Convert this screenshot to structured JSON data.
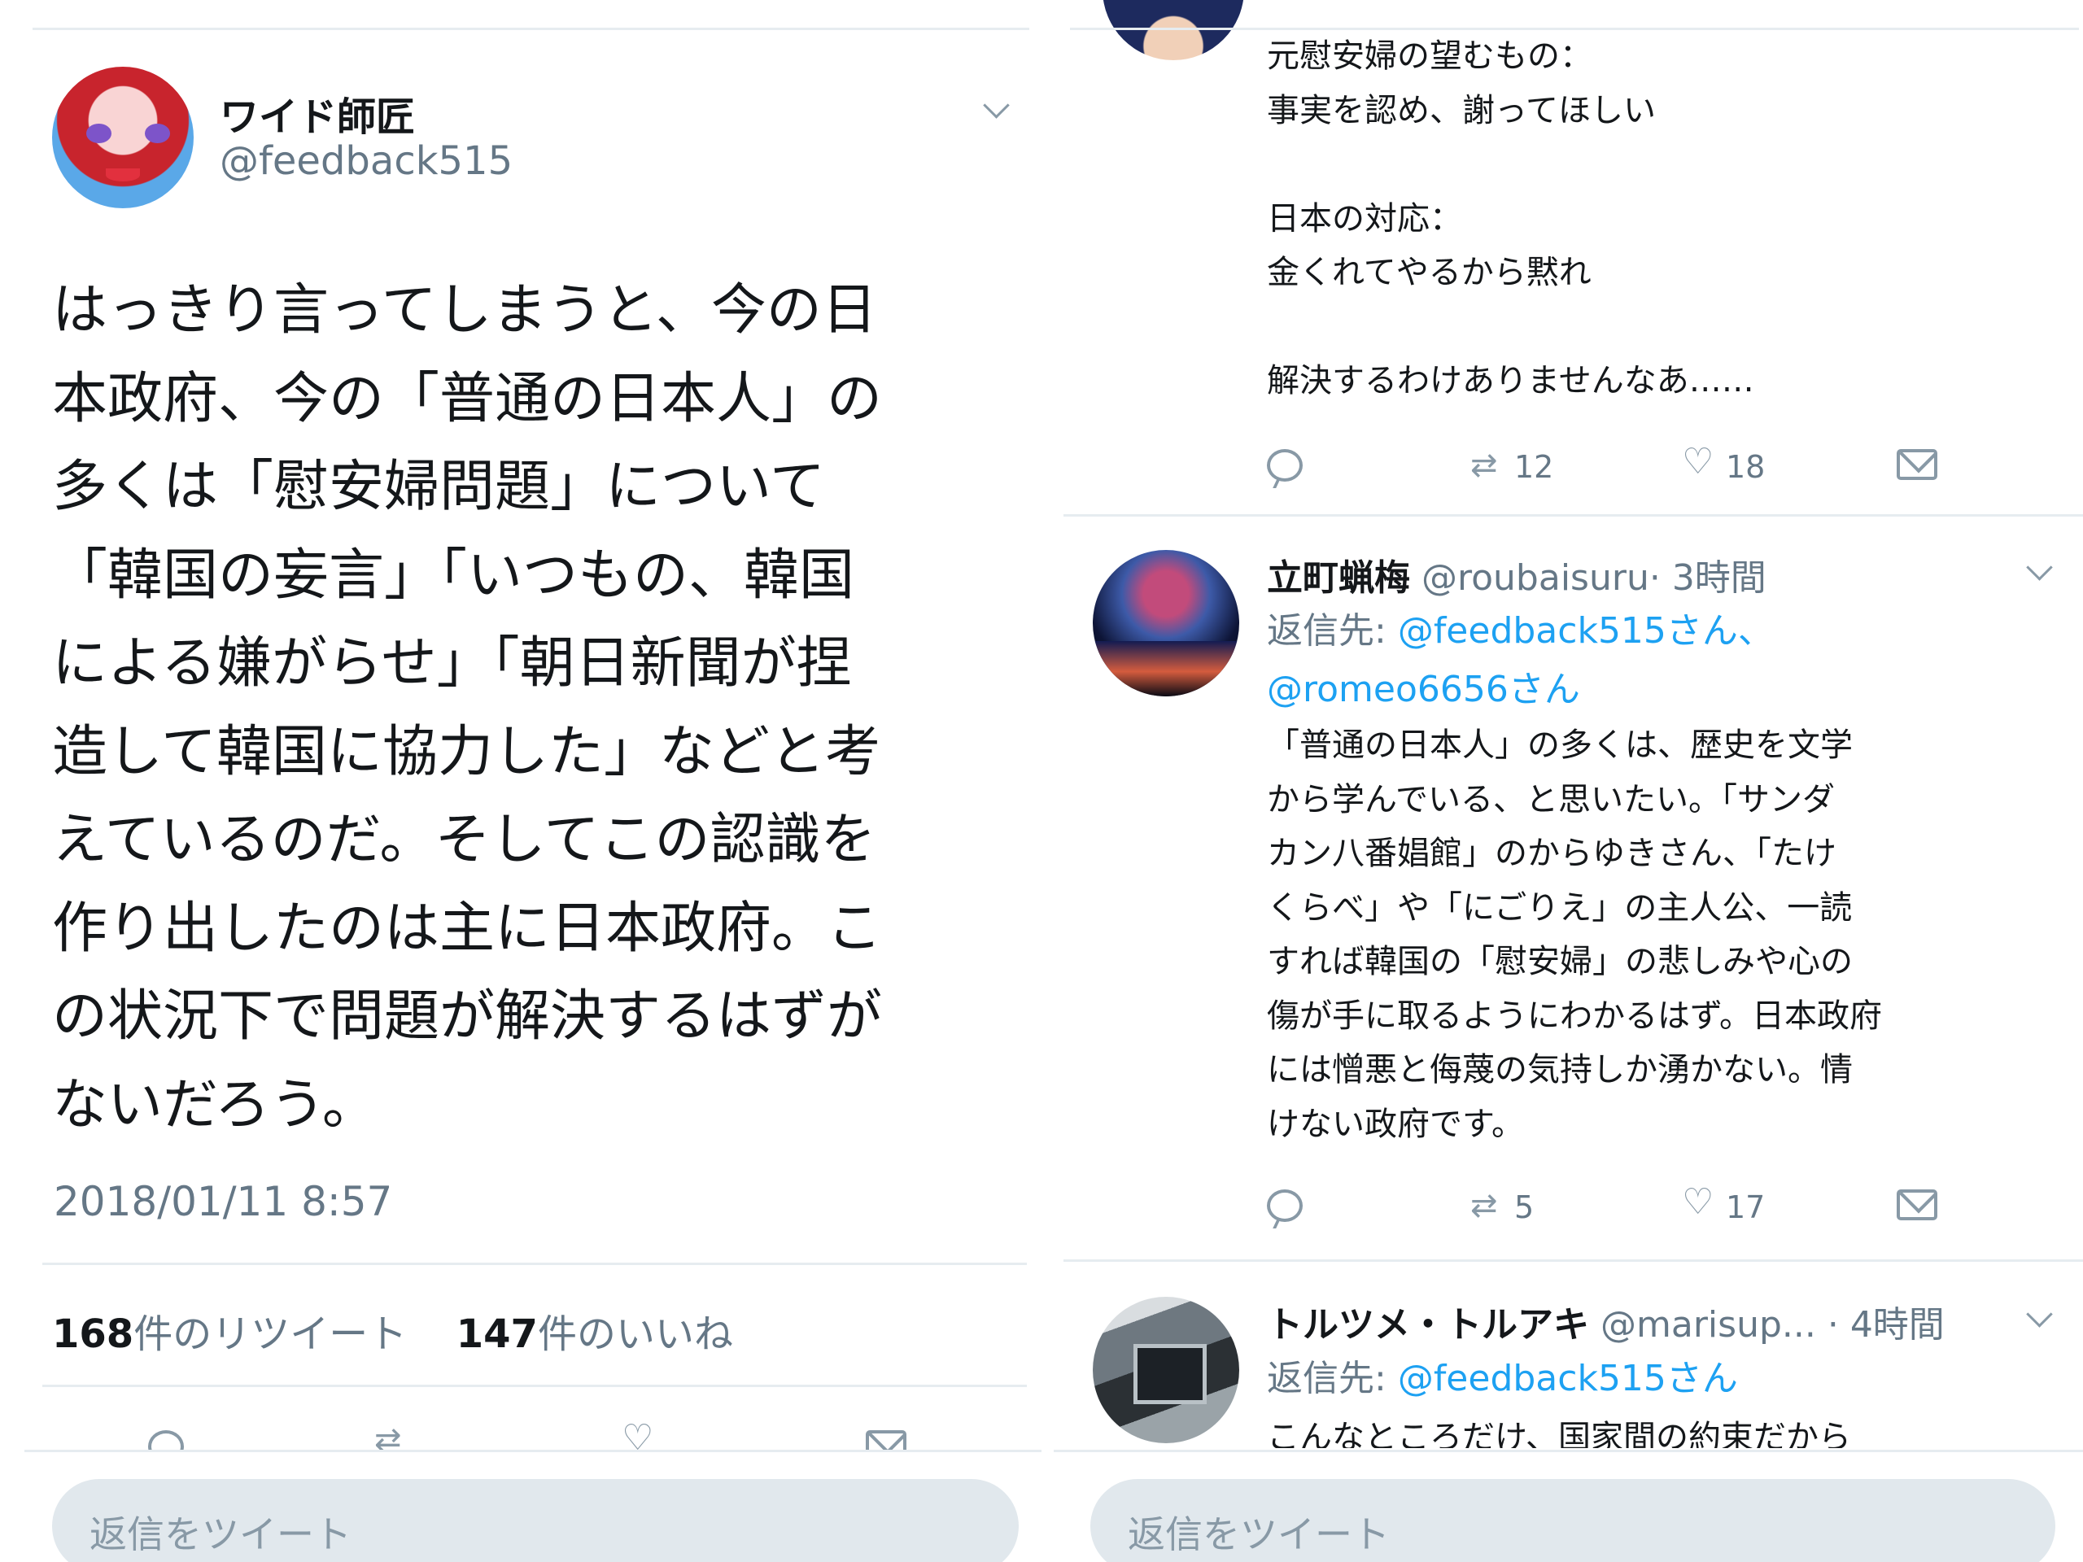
{
  "left": {
    "author": {
      "name": "ワイド師匠",
      "handle": "@feedback515"
    },
    "body_lines": [
      "はっきり言ってしまうと、今の日",
      "本政府、今の「普通の日本人」の",
      "多くは「慰安婦問題」について",
      "「韓国の妄言」「いつもの、韓国",
      "による嫌がらせ」「朝日新聞が捏",
      "造して韓国に協力した」などと考",
      "えているのだ。そしてこの認識を",
      "作り出したのは主に日本政府。こ",
      "の状況下で問題が解決するはずが",
      "ないだろう。"
    ],
    "timestamp": "2018/01/11 8:57",
    "stats": {
      "retweet_count": "168",
      "retweet_label": "件のリツイート",
      "like_count": "147",
      "like_label": "件のいいね"
    },
    "reply_placeholder": "返信をツイート"
  },
  "right": {
    "tweet1": {
      "text": "元慰安婦の望むもの：\n事実を認め、謝ってほしい\n\n日本の対応：\n金くれてやるから黙れ\n\n解決するわけありませんなあ……",
      "retweets": "12",
      "likes": "18"
    },
    "tweet2": {
      "name": "立町蝋梅",
      "handle": "@roubaisuru",
      "time": "· 3時間",
      "reply_prefix": "返信先: ",
      "reply_to_1": "@feedback515さん、",
      "reply_to_2": "@romeo6656さん",
      "text": "「普通の日本人」の多くは、歴史を文学\nから学んでいる、と思いたい。「サンダ\nカン八番娼館」のからゆきさん、「たけ\nくらべ」や「にごりえ」の主人公、一読\nすれば韓国の「慰安婦」の悲しみや心の\n傷が手に取るようにわかるはず。日本政府\nには憎悪と侮蔑の気持しか湧かない。情\nけない政府です。",
      "retweets": "5",
      "likes": "17"
    },
    "tweet3": {
      "name": "トルツメ・トルアキ",
      "handle": "@marisup...",
      "time": "· 4時間",
      "reply_prefix": "返信先: ",
      "reply_to_1": "@feedback515さん",
      "text": "こんなところだけ、国家間の約束だから"
    },
    "reply_placeholder": "返信をツイート"
  },
  "icons": {
    "retweet": "⇄",
    "like": "♡",
    "reply": "reply-icon",
    "dm": "envelope-icon"
  }
}
